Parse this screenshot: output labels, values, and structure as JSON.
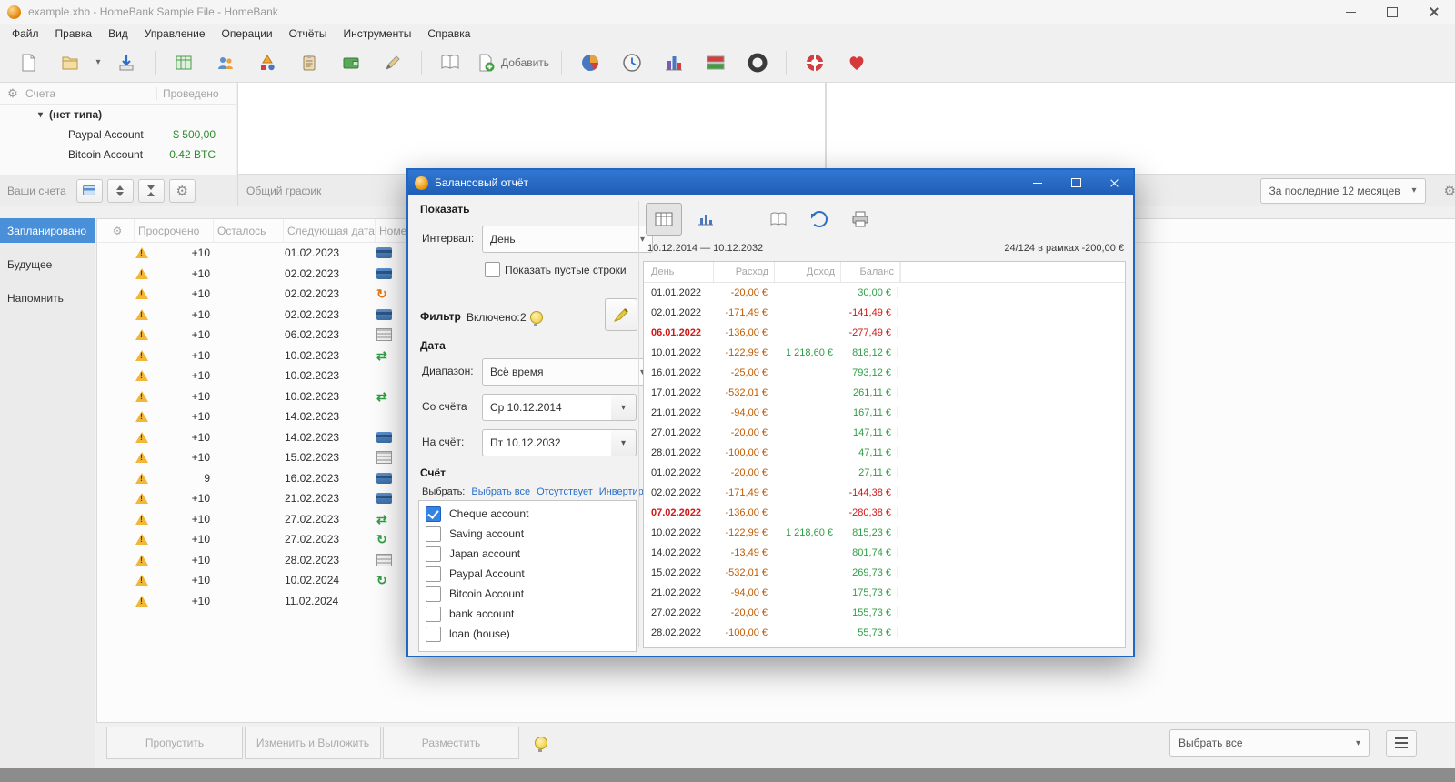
{
  "window": {
    "title": "example.xhb - HomeBank Sample File - HomeBank",
    "menu": [
      "Файл",
      "Правка",
      "Вид",
      "Управление",
      "Операции",
      "Отчёты",
      "Инструменты",
      "Справка"
    ],
    "toolbar": {
      "add_label": "Добавить"
    }
  },
  "icons": {
    "gear": "⚙",
    "dropdown": "▾",
    "expander": "▾",
    "transfer": "⇄",
    "repeat": "↻"
  },
  "colors": {
    "expense": "#c05a00",
    "income": "#2f9e44",
    "positive_balance": "#2f9e44",
    "negative_balance": "#d01818",
    "dialog_titlebar": "#2166c0",
    "selected_tab": "#4a90d9",
    "account_balance": "#2e8b2e"
  },
  "accounts_panel": {
    "col_name": "Счета",
    "col_status": "Проведено",
    "group_label": "(нет типа)",
    "items": [
      {
        "name": "Paypal Account",
        "balance": "$ 500,00"
      },
      {
        "name": "Bitcoin Account",
        "balance": "0.42 BTC"
      }
    ],
    "footer_label": "Ваши счета"
  },
  "chart_header": {
    "label": "Общий график"
  },
  "range_filter": {
    "value": "За последние 12 месяцев"
  },
  "scheduled": {
    "tabs": [
      {
        "label": "Запланировано",
        "active": true
      },
      {
        "label": "Будущее",
        "active": false
      },
      {
        "label": "Напомнить",
        "active": false
      }
    ],
    "columns": [
      "Просрочено",
      "Осталось",
      "Следующая дата",
      "Номер т"
    ],
    "rows": [
      {
        "overdue": "+10",
        "date": "01.02.2023",
        "pay_icon": "card"
      },
      {
        "overdue": "+10",
        "date": "02.02.2023",
        "pay_icon": "card"
      },
      {
        "overdue": "+10",
        "date": "02.02.2023",
        "pay_icon": "repeat-orange"
      },
      {
        "overdue": "+10",
        "date": "02.02.2023",
        "pay_icon": "card"
      },
      {
        "overdue": "+10",
        "date": "06.02.2023",
        "pay_icon": "bars"
      },
      {
        "overdue": "+10",
        "date": "10.02.2023",
        "pay_icon": "transfer"
      },
      {
        "overdue": "+10",
        "date": "10.02.2023",
        "pay_icon": "none"
      },
      {
        "overdue": "+10",
        "date": "10.02.2023",
        "pay_icon": "transfer"
      },
      {
        "overdue": "+10",
        "date": "14.02.2023",
        "pay_icon": "none"
      },
      {
        "overdue": "+10",
        "date": "14.02.2023",
        "pay_icon": "card"
      },
      {
        "overdue": "+10",
        "date": "15.02.2023",
        "pay_icon": "bars"
      },
      {
        "overdue": "9",
        "date": "16.02.2023",
        "pay_icon": "card"
      },
      {
        "overdue": "+10",
        "date": "21.02.2023",
        "pay_icon": "card"
      },
      {
        "overdue": "+10",
        "date": "27.02.2023",
        "pay_icon": "transfer"
      },
      {
        "overdue": "+10",
        "date": "27.02.2023",
        "pay_icon": "repeat-green"
      },
      {
        "overdue": "+10",
        "date": "28.02.2023",
        "pay_icon": "bars"
      },
      {
        "overdue": "+10",
        "date": "10.02.2024",
        "pay_icon": "repeat-green"
      },
      {
        "overdue": "+10",
        "date": "11.02.2024",
        "pay_icon": "none"
      }
    ],
    "buttons": [
      "Пропустить",
      "Изменить и Выложить",
      "Разместить"
    ]
  },
  "bottom_right": {
    "select_all": "Выбрать все"
  },
  "dialog": {
    "title": "Балансовый отчёт",
    "left": {
      "show_label": "Показать",
      "interval_label": "Интервал:",
      "interval_value": "День",
      "empty_rows_label": "Показать пустые строки",
      "filter_label": "Фильтр",
      "enabled_label": "Включено:",
      "enabled_count": "2",
      "date_label": "Дата",
      "range_label": "Диапазон:",
      "range_value": "Всё время",
      "from_label": "Со счёта",
      "from_value": "Ср 10.12.2014",
      "to_label": "На счёт:",
      "to_value": "Пт 10.12.2032",
      "account_label": "Счёт",
      "select_label": "Выбрать:",
      "links": [
        "Выбрать все",
        "Отсутствует",
        "Инвертировать"
      ],
      "accounts": [
        {
          "name": "Cheque account",
          "checked": true
        },
        {
          "name": "Saving account",
          "checked": false
        },
        {
          "name": "Japan account",
          "checked": false
        },
        {
          "name": "Paypal Account",
          "checked": false
        },
        {
          "name": "Bitcoin Account",
          "checked": false
        },
        {
          "name": "bank account",
          "checked": false
        },
        {
          "name": "loan (house)",
          "checked": false
        }
      ]
    },
    "report": {
      "date_range": "10.12.2014 — 10.12.2032",
      "summary": "24/124 в рамках -200,00 €",
      "columns": [
        "День",
        "Расход",
        "Доход",
        "Баланс"
      ],
      "rows": [
        {
          "date": "01.01.2022",
          "expense": "-20,00 €",
          "income": "",
          "balance": "30,00 €",
          "alert": false,
          "neg": false
        },
        {
          "date": "02.01.2022",
          "expense": "-171,49 €",
          "income": "",
          "balance": "-141,49 €",
          "alert": false,
          "neg": true
        },
        {
          "date": "06.01.2022",
          "expense": "-136,00 €",
          "income": "",
          "balance": "-277,49 €",
          "alert": true,
          "neg": true
        },
        {
          "date": "10.01.2022",
          "expense": "-122,99 €",
          "income": "1 218,60 €",
          "balance": "818,12 €",
          "alert": false,
          "neg": false
        },
        {
          "date": "16.01.2022",
          "expense": "-25,00 €",
          "income": "",
          "balance": "793,12 €",
          "alert": false,
          "neg": false
        },
        {
          "date": "17.01.2022",
          "expense": "-532,01 €",
          "income": "",
          "balance": "261,11 €",
          "alert": false,
          "neg": false
        },
        {
          "date": "21.01.2022",
          "expense": "-94,00 €",
          "income": "",
          "balance": "167,11 €",
          "alert": false,
          "neg": false
        },
        {
          "date": "27.01.2022",
          "expense": "-20,00 €",
          "income": "",
          "balance": "147,11 €",
          "alert": false,
          "neg": false
        },
        {
          "date": "28.01.2022",
          "expense": "-100,00 €",
          "income": "",
          "balance": "47,11 €",
          "alert": false,
          "neg": false
        },
        {
          "date": "01.02.2022",
          "expense": "-20,00 €",
          "income": "",
          "balance": "27,11 €",
          "alert": false,
          "neg": false
        },
        {
          "date": "02.02.2022",
          "expense": "-171,49 €",
          "income": "",
          "balance": "-144,38 €",
          "alert": false,
          "neg": true
        },
        {
          "date": "07.02.2022",
          "expense": "-136,00 €",
          "income": "",
          "balance": "-280,38 €",
          "alert": true,
          "neg": true
        },
        {
          "date": "10.02.2022",
          "expense": "-122,99 €",
          "income": "1 218,60 €",
          "balance": "815,23 €",
          "alert": false,
          "neg": false
        },
        {
          "date": "14.02.2022",
          "expense": "-13,49 €",
          "income": "",
          "balance": "801,74 €",
          "alert": false,
          "neg": false
        },
        {
          "date": "15.02.2022",
          "expense": "-532,01 €",
          "income": "",
          "balance": "269,73 €",
          "alert": false,
          "neg": false
        },
        {
          "date": "21.02.2022",
          "expense": "-94,00 €",
          "income": "",
          "balance": "175,73 €",
          "alert": false,
          "neg": false
        },
        {
          "date": "27.02.2022",
          "expense": "-20,00 €",
          "income": "",
          "balance": "155,73 €",
          "alert": false,
          "neg": false
        },
        {
          "date": "28.02.2022",
          "expense": "-100,00 €",
          "income": "",
          "balance": "55,73 €",
          "alert": false,
          "neg": false
        }
      ]
    }
  }
}
